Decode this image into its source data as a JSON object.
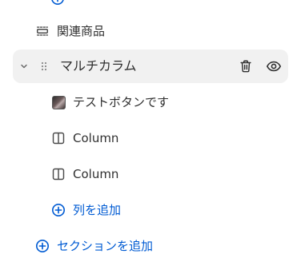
{
  "tree": {
    "related_products": {
      "label": "関連商品",
      "icon": "section-layout-icon"
    },
    "multicolumn": {
      "label": "マルチカラム",
      "expanded": true,
      "icons": {
        "toggle": "chevron-down-icon",
        "drag": "drag-handle-icon",
        "delete": "trash-icon",
        "visibility": "eye-icon"
      },
      "blocks": [
        {
          "label": "テストボタンです",
          "icon": "image-thumbnail"
        },
        {
          "label": "Column",
          "icon": "column-icon"
        },
        {
          "label": "Column",
          "icon": "column-icon"
        }
      ],
      "add_block_label": "列を追加"
    },
    "add_section_label": "セクションを追加"
  },
  "colors": {
    "accent": "#005bd3",
    "text": "#303030",
    "row_highlight": "#f1f1f1",
    "icon": "#4a4a4a"
  }
}
